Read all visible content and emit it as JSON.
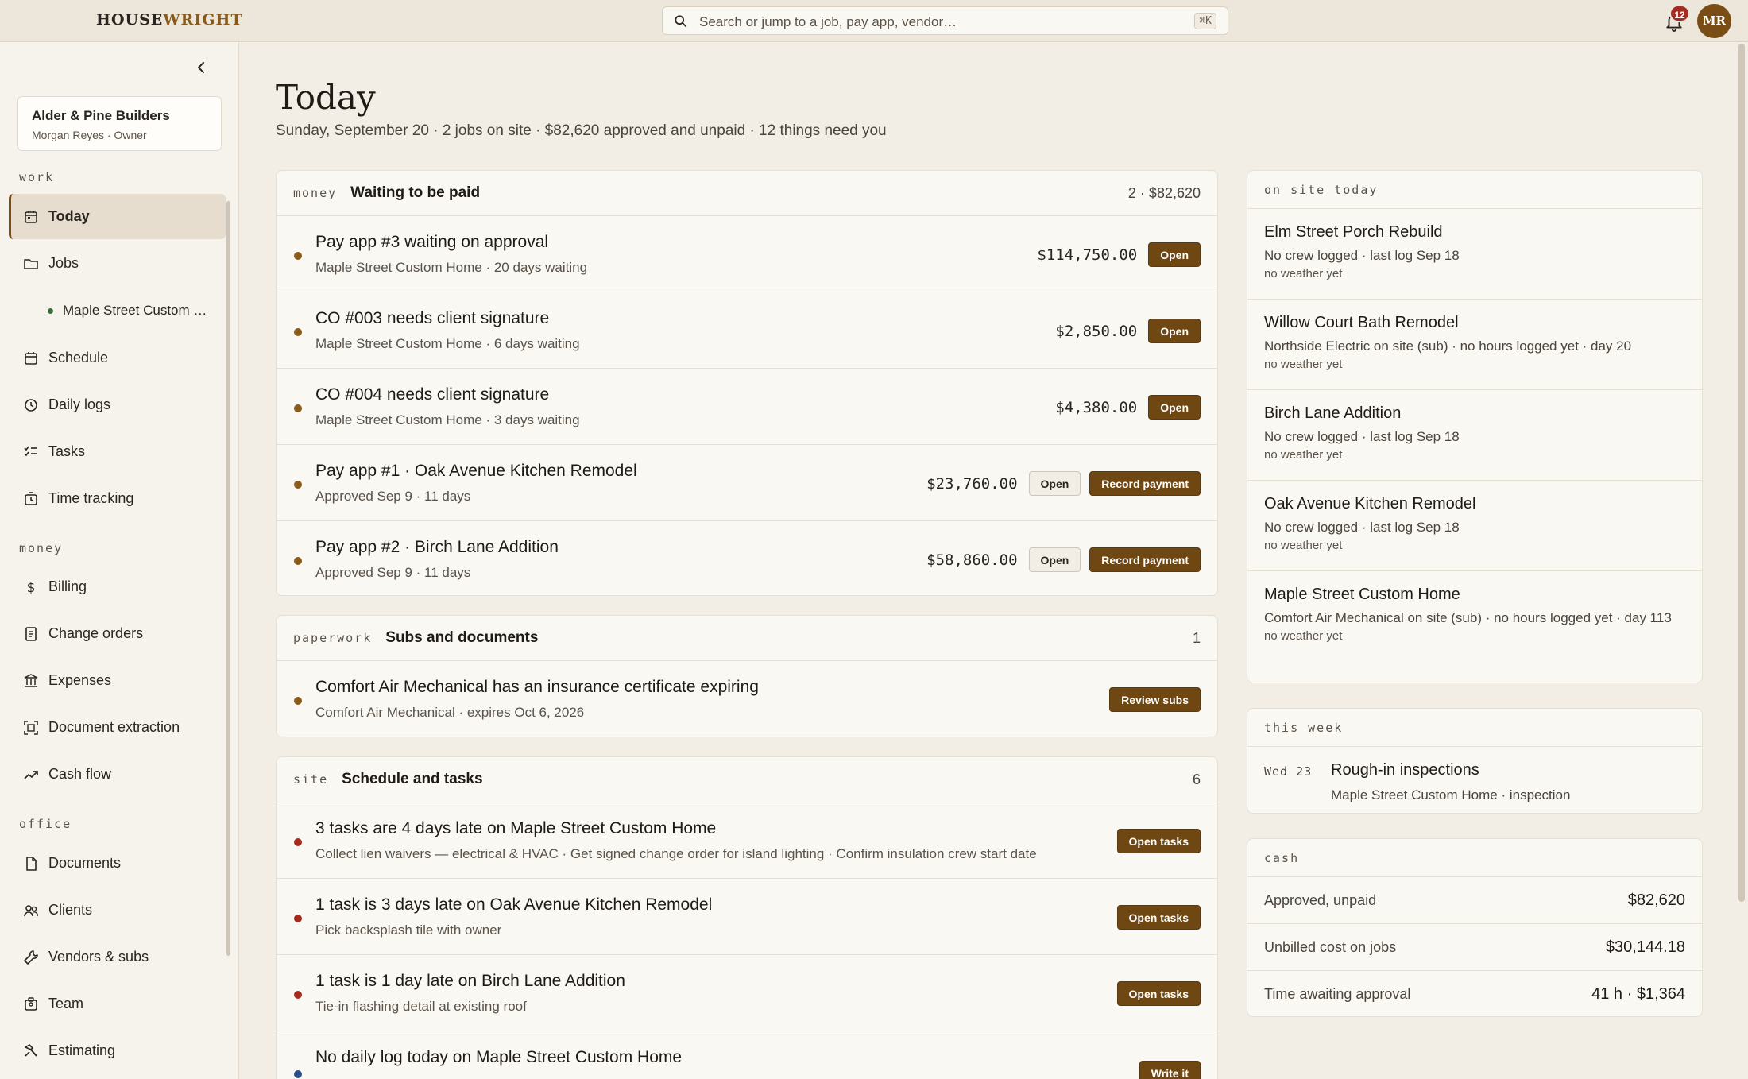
{
  "app": {
    "logo_a": "HOUSE",
    "logo_b": "WRIGHT",
    "search_placeholder": "Search or jump to a job, pay app, vendor…",
    "search_shortcut": "⌘K",
    "notifications_count": "12",
    "avatar_initials": "MR"
  },
  "sidebar": {
    "org_name": "Alder & Pine Builders",
    "org_user": "Morgan Reyes · Owner",
    "sections": {
      "work": "work",
      "money": "money",
      "office": "office"
    },
    "items": {
      "today": "Today",
      "jobs": "Jobs",
      "job_sub": "Maple Street Custom Home",
      "schedule": "Schedule",
      "daily_logs": "Daily logs",
      "tasks": "Tasks",
      "time_tracking": "Time tracking",
      "billing": "Billing",
      "change_orders": "Change orders",
      "expenses": "Expenses",
      "document_extraction": "Document extraction",
      "cash_flow": "Cash flow",
      "documents": "Documents",
      "clients": "Clients",
      "vendors": "Vendors & subs",
      "team": "Team",
      "estimating": "Estimating"
    }
  },
  "header": {
    "title": "Today",
    "subtitle": "Sunday, September 20 · 2 jobs on site · $82,620 approved and unpaid · 12 things need you"
  },
  "money": {
    "tag": "money",
    "title": "Waiting to be paid",
    "count": "2 · $82,620",
    "rows": [
      {
        "title": "Pay app #3 waiting on approval",
        "sub": "Maple Street Custom Home · 20 days waiting",
        "amount": "$114,750.00",
        "btn": "Open"
      },
      {
        "title": "CO #003 needs client signature",
        "sub": "Maple Street Custom Home · 6 days waiting",
        "amount": "$2,850.00",
        "btn": "Open"
      },
      {
        "title": "CO #004 needs client signature",
        "sub": "Maple Street Custom Home · 3 days waiting",
        "amount": "$4,380.00",
        "btn": "Open"
      },
      {
        "title": "Pay app #1 · Oak Avenue Kitchen Remodel",
        "sub": "Approved Sep 9 · 11 days",
        "amount": "$23,760.00",
        "btn": "Open",
        "btn2": "Record payment"
      },
      {
        "title": "Pay app #2 · Birch Lane Addition",
        "sub": "Approved Sep 9 · 11 days",
        "amount": "$58,860.00",
        "btn": "Open",
        "btn2": "Record payment"
      }
    ]
  },
  "paperwork": {
    "tag": "paperwork",
    "title": "Subs and documents",
    "count": "1",
    "rows": [
      {
        "title": "Comfort Air Mechanical has an insurance certificate expiring",
        "sub": "Comfort Air Mechanical · expires Oct 6, 2026",
        "btn": "Review subs"
      }
    ]
  },
  "site": {
    "tag": "site",
    "title": "Schedule and tasks",
    "count": "6",
    "rows": [
      {
        "title": "3 tasks are 4 days late on Maple Street Custom Home",
        "sub": "Collect lien waivers — electrical & HVAC · Get signed change order for island lighting · Confirm insulation crew start date",
        "btn": "Open tasks"
      },
      {
        "title": "1 task is 3 days late on Oak Avenue Kitchen Remodel",
        "sub": "Pick backsplash tile with owner",
        "btn": "Open tasks"
      },
      {
        "title": "1 task is 1 day late on Birch Lane Addition",
        "sub": "Tie-in flashing detail at existing roof",
        "btn": "Open tasks"
      },
      {
        "title": "No daily log today on Maple Street Custom Home",
        "sub": "",
        "btn": "Write it"
      }
    ]
  },
  "on_site": {
    "tag": "on site today",
    "items": [
      {
        "title": "Elm Street Porch Rebuild",
        "sub": "No crew logged · last log Sep 18",
        "meta": "no weather yet"
      },
      {
        "title": "Willow Court Bath Remodel",
        "sub": "Northside Electric on site (sub) · no hours logged yet · day 20",
        "meta": "no weather yet"
      },
      {
        "title": "Birch Lane Addition",
        "sub": "No crew logged · last log Sep 18",
        "meta": "no weather yet"
      },
      {
        "title": "Oak Avenue Kitchen Remodel",
        "sub": "No crew logged · last log Sep 18",
        "meta": "no weather yet"
      },
      {
        "title": "Maple Street Custom Home",
        "sub": "Comfort Air Mechanical on site (sub) · no hours logged yet · day 113",
        "meta": "no weather yet"
      }
    ]
  },
  "this_week": {
    "tag": "this week",
    "items": [
      {
        "date": "Wed 23",
        "title": "Rough-in inspections",
        "sub": "Maple Street Custom Home · inspection"
      }
    ]
  },
  "cash": {
    "tag": "cash",
    "rows": [
      {
        "label": "Approved, unpaid",
        "value": "$82,620"
      },
      {
        "label": "Unbilled cost on jobs",
        "value": "$30,144.18"
      },
      {
        "label": "Time awaiting approval",
        "value": "41 h · $1,364"
      }
    ]
  },
  "colors": {
    "accent": "#6e4712",
    "background": "#f2eee6",
    "dot_amber": "#8a5a1a",
    "dot_red": "#a52a22",
    "dot_blue": "#2c4f8a"
  }
}
